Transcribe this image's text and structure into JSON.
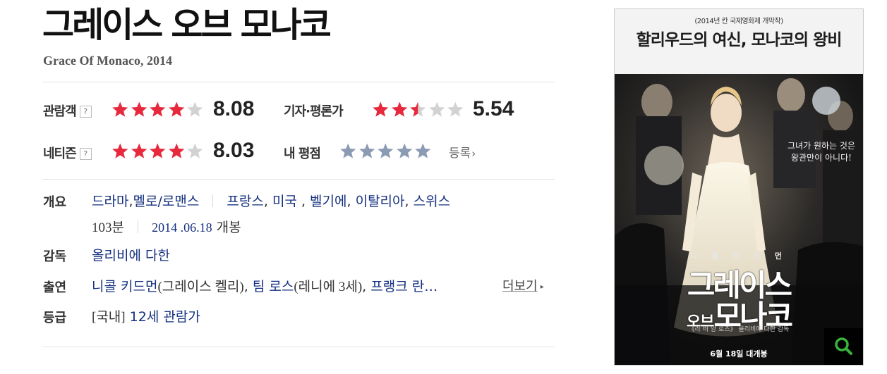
{
  "movie": {
    "title": "그레이스 오브 모나코",
    "subtitle": "Grace Of Monaco, 2014"
  },
  "ratings": {
    "audience": {
      "label": "관람객",
      "help": "?",
      "score": "8.08",
      "stars_filled": 4
    },
    "critics": {
      "label": "기자·평론가",
      "score": "5.54",
      "stars_filled": 2.5
    },
    "netizen": {
      "label": "네티즌",
      "help": "?",
      "score": "8.03",
      "stars_filled": 4
    },
    "mine": {
      "label": "내 평점",
      "stars_filled": 0,
      "register_label": "등록",
      "register_chevron": "›"
    }
  },
  "info": {
    "overview": {
      "label": "개요",
      "genres": [
        "드라마",
        "멜로/로맨스"
      ],
      "countries": [
        "프랑스",
        "미국",
        "벨기에",
        "이탈리아",
        "스위스"
      ],
      "runtime": "103분",
      "release_date": "2014 .06.18",
      "release_suffix": "개봉"
    },
    "director": {
      "label": "감독",
      "name": "올리비에 다한"
    },
    "cast": {
      "label": "출연",
      "members": [
        {
          "name": "니콜 키드먼",
          "role": "(그레이스 켈리)"
        },
        {
          "name": "팀 로스",
          "role": "(레니에 3세)"
        }
      ],
      "truncated_name": "프랭크 란…",
      "more_label": "더보기",
      "more_icon": "▸"
    },
    "grade": {
      "label": "등급",
      "region": "[국내]",
      "value": "12세 관람가"
    }
  },
  "poster": {
    "top_note": "(2014년 칸 국제영화제 개막작)",
    "tagline": "할리우드의 여신, 모나코의 왕비",
    "quote_line1": "그녀가 원하는 것은",
    "quote_line2": "왕관만이 아니다!",
    "actor": "니 콜 키 드 먼",
    "title_line1": "그레이스",
    "title_line2_small": "오브",
    "title_line2": "모나코",
    "credit": "《라 비 앙 로즈》 올리비에 다한 감독",
    "release": "6월 18일 대개봉",
    "zoom_icon": "search-icon"
  },
  "colors": {
    "star_red": "#e8283c",
    "star_grey": "#d2d2d2",
    "star_blue": "#8b9bb4",
    "link": "#14307f"
  }
}
